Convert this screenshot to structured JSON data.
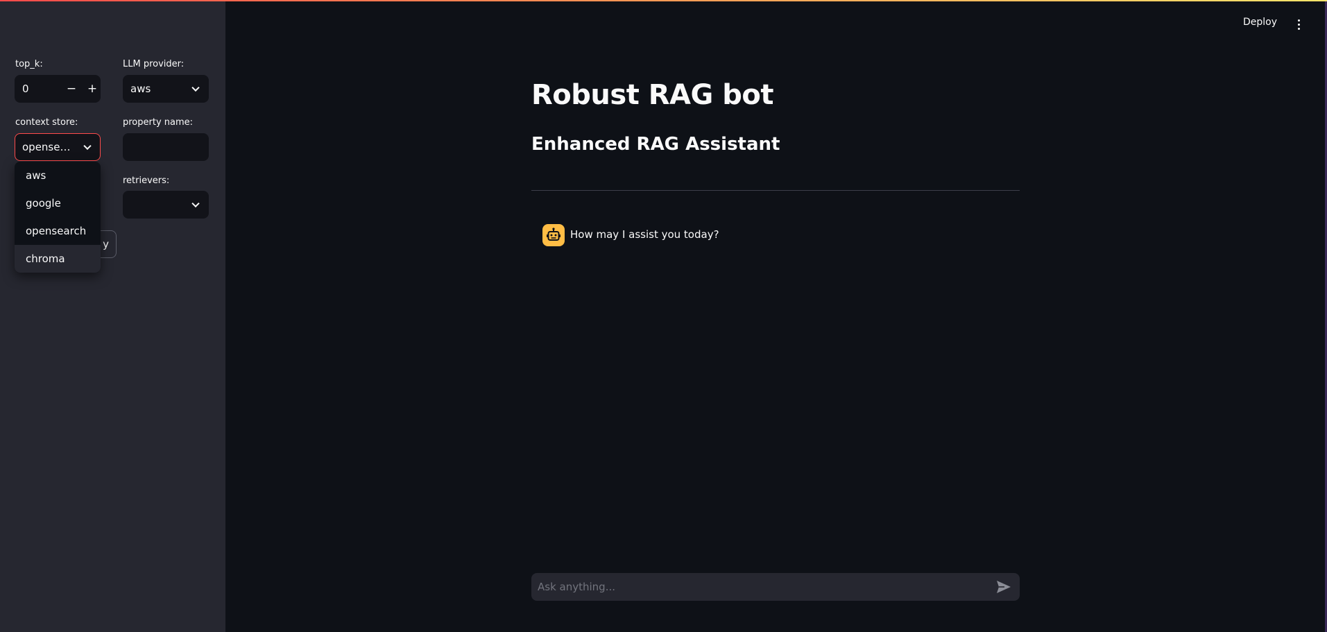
{
  "sidebar": {
    "top_k": {
      "label": "top_k:",
      "value": "0",
      "decrement": "−",
      "increment": "+"
    },
    "llm_provider": {
      "label": "LLM provider:",
      "value": "aws"
    },
    "context_store": {
      "label": "context store:",
      "value": "opense…"
    },
    "property_name": {
      "label": "property name:",
      "value": ""
    },
    "retrievers": {
      "label": "retrievers:",
      "value": ""
    },
    "partial_button_label": "y",
    "dropdown_options": [
      "aws",
      "google",
      "opensearch",
      "chroma"
    ]
  },
  "header": {
    "deploy_label": "Deploy",
    "menu_icon": "kebab-menu-icon"
  },
  "main": {
    "title": "Robust RAG bot",
    "subtitle": "Enhanced RAG Assistant",
    "messages": [
      {
        "role": "assistant",
        "avatar_icon": "robot-icon",
        "text": "How may I assist you today?"
      }
    ]
  },
  "chat_input": {
    "placeholder": "Ask anything...",
    "send_icon": "send-icon"
  },
  "colors": {
    "accent": "#ff4b4b",
    "avatar": "#ffbd45",
    "background": "#0e1117",
    "sidebar": "#262730"
  }
}
